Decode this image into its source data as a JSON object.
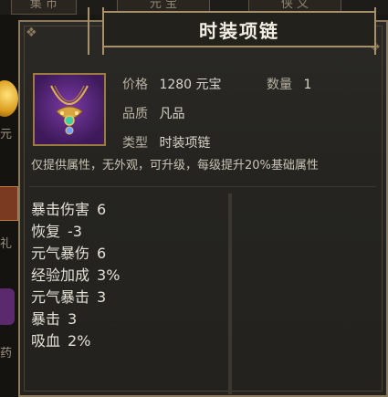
{
  "background": {
    "tabs": [
      "集 币",
      "元 宝",
      "侠 义"
    ],
    "left_labels": [
      "元",
      "礼",
      "药"
    ]
  },
  "dialog": {
    "title": "时装项链",
    "price_label": "价格",
    "price_value": "1280 元宝",
    "quantity_label": "数量",
    "quantity_value": "1",
    "quality_label": "品质",
    "quality_value": "凡品",
    "type_label": "类型",
    "type_value": "时装项链",
    "description": "仅提供属性，无外观，可升级，每级提升20%基础属性",
    "item_icon": "necklace-icon",
    "stats": [
      {
        "name": "暴击伤害",
        "value": "6"
      },
      {
        "name": "恢复",
        "value": "-3"
      },
      {
        "name": "元气暴伤",
        "value": "6"
      },
      {
        "name": "经验加成",
        "value": "3%"
      },
      {
        "name": "元气暴击",
        "value": "3"
      },
      {
        "name": "暴击",
        "value": "3"
      },
      {
        "name": "吸血",
        "value": "2%"
      }
    ]
  },
  "colors": {
    "panel_bg": "#252420",
    "frame_gold": "#a6916a",
    "icon_bg": "#5a2a80"
  }
}
